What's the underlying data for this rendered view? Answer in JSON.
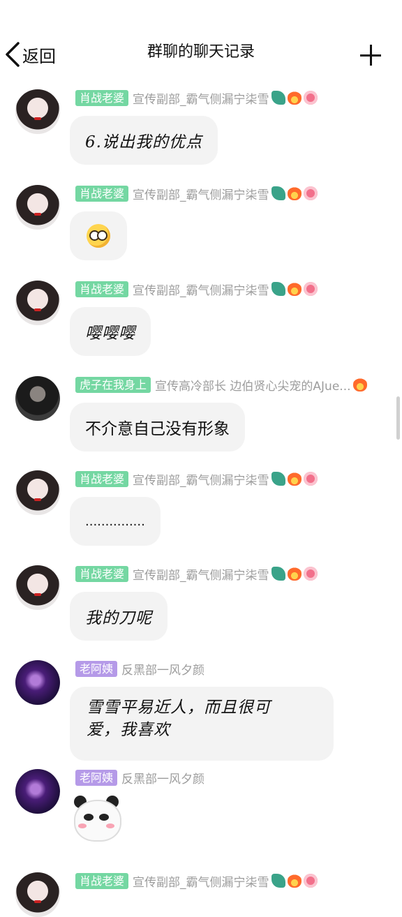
{
  "header": {
    "back_label": "返回",
    "title": "群聊的聊天记录",
    "add_icon": "plus-icon"
  },
  "badges": {
    "dragon": "dragon-badge-icon",
    "fire": "fire-badge-icon",
    "face": "face-badge-icon"
  },
  "colors": {
    "tag_green": "#74d7a2",
    "tag_purple": "#b59ae8",
    "bubble_bg": "#f3f3f3",
    "name_gray": "#9c9c9c"
  },
  "messages": [
    {
      "tag": "肖战老婆",
      "name": "宣传副部_霸气侧漏宁柒雪",
      "text": "6.说出我的优点"
    },
    {
      "tag": "肖战老婆",
      "name": "宣传副部_霸气侧漏宁柒雪",
      "emoji": "pleading-face-emoji"
    },
    {
      "tag": "肖战老婆",
      "name": "宣传副部_霸气侧漏宁柒雪",
      "text": "嘤嘤嘤"
    },
    {
      "tag": "虎子在我身上",
      "name": "宣传高冷部长  边伯贤心尖宠的AJue...",
      "text": "不介意自己没有形象"
    },
    {
      "tag": "肖战老婆",
      "name": "宣传副部_霸气侧漏宁柒雪",
      "text": "..............."
    },
    {
      "tag": "肖战老婆",
      "name": "宣传副部_霸气侧漏宁柒雪",
      "text": "我的刀呢"
    },
    {
      "tag": "老阿姨",
      "name": "反黑部一风夕颜",
      "text_line1": "雪雪平易近人，而且很可",
      "text_line2": "爱，我喜欢"
    },
    {
      "tag": "老阿姨",
      "name": "反黑部一风夕颜",
      "sticker": "panda-sticker"
    },
    {
      "tag": "肖战老婆",
      "name": "宣传副部_霸气侧漏宁柒雪"
    }
  ]
}
